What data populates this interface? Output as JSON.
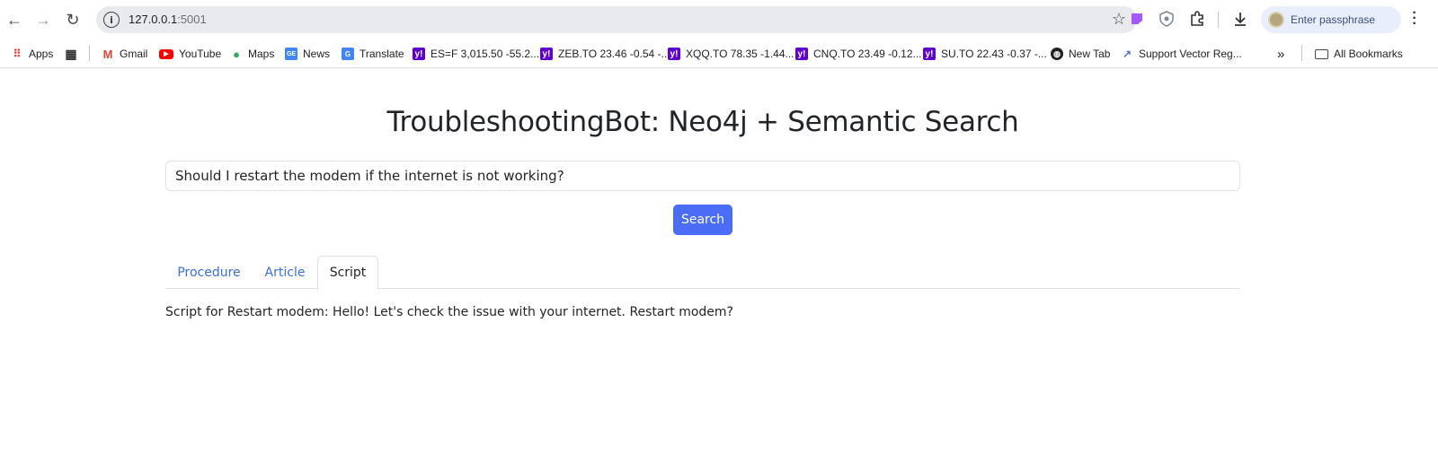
{
  "browser": {
    "url_host": "127.0.0.1",
    "url_port": ":5001",
    "passphrase_label": "Enter passphrase"
  },
  "bookmarks": {
    "apps": "Apps",
    "gmail": "Gmail",
    "youtube": "YouTube",
    "maps": "Maps",
    "news": "News",
    "translate": "Translate",
    "esf": "ES=F 3,015.50 -55.2...",
    "zeb": "ZEB.TO 23.46 -0.54 -...",
    "xqq": "XQQ.TO 78.35 -1.44...",
    "cnq": "CNQ.TO 23.49 -0.12...",
    "su": "SU.TO 22.43 -0.37 -...",
    "newtab": "New Tab",
    "svr": "Support Vector Reg...",
    "more": "»",
    "all_bookmarks": "All Bookmarks"
  },
  "page": {
    "title": "TroubleshootingBot: Neo4j + Semantic Search",
    "search_value": "Should I restart the modem if the internet is not working?",
    "search_button": "Search",
    "tabs": [
      "Procedure",
      "Article",
      "Script"
    ],
    "active_tab": "Script",
    "result_text": "Script for Restart modem: Hello! Let's check the issue with your internet. Restart modem?"
  },
  "colors": {
    "accent": "#4a6cf7",
    "tab_link": "#3d6fd6",
    "yahoo": "#6001d2"
  }
}
